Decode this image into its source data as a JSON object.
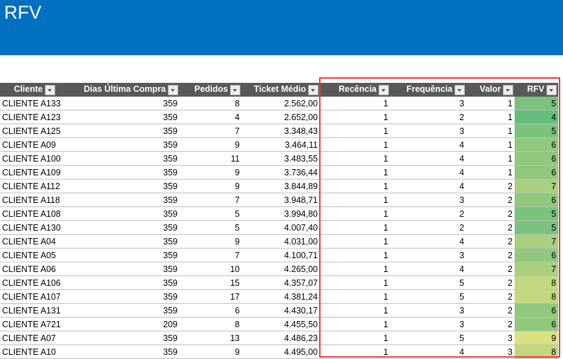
{
  "title": "RFV",
  "headers": [
    "Cliente",
    "Dias Última Compra",
    "Pedidos",
    "Ticket Médio",
    "Recência",
    "Frequência",
    "Valor",
    "RFV"
  ],
  "rfv_colors": {
    "4": "#63be7b",
    "5": "#79c37c",
    "6": "#90c97d",
    "7": "#a8d07e",
    "8": "#c2d87f",
    "9": "#dbe180"
  },
  "rows": [
    [
      "CLIENTE A133",
      "359",
      "8",
      "2.562,00",
      "1",
      "3",
      "1",
      "5"
    ],
    [
      "CLIENTE A123",
      "359",
      "4",
      "2.652,00",
      "1",
      "2",
      "1",
      "4"
    ],
    [
      "CLIENTE A125",
      "359",
      "7",
      "3.348,43",
      "1",
      "3",
      "1",
      "5"
    ],
    [
      "CLIENTE A09",
      "359",
      "9",
      "3.464,11",
      "1",
      "4",
      "1",
      "6"
    ],
    [
      "CLIENTE A100",
      "359",
      "11",
      "3.483,55",
      "1",
      "4",
      "1",
      "6"
    ],
    [
      "CLIENTE A109",
      "359",
      "9",
      "3.736,44",
      "1",
      "4",
      "1",
      "6"
    ],
    [
      "CLIENTE A112",
      "359",
      "9",
      "3.844,89",
      "1",
      "4",
      "2",
      "7"
    ],
    [
      "CLIENTE A118",
      "359",
      "7",
      "3.948,71",
      "1",
      "3",
      "2",
      "6"
    ],
    [
      "CLIENTE A108",
      "359",
      "5",
      "3.994,80",
      "1",
      "2",
      "2",
      "5"
    ],
    [
      "CLIENTE A130",
      "359",
      "5",
      "4.007,40",
      "1",
      "2",
      "2",
      "5"
    ],
    [
      "CLIENTE A04",
      "359",
      "9",
      "4.031,00",
      "1",
      "4",
      "2",
      "7"
    ],
    [
      "CLIENTE A05",
      "359",
      "7",
      "4.100,71",
      "1",
      "3",
      "2",
      "6"
    ],
    [
      "CLIENTE A06",
      "359",
      "10",
      "4.265,00",
      "1",
      "4",
      "2",
      "7"
    ],
    [
      "CLIENTE A106",
      "359",
      "15",
      "4.357,07",
      "1",
      "5",
      "2",
      "8"
    ],
    [
      "CLIENTE A107",
      "359",
      "17",
      "4.381,24",
      "1",
      "5",
      "2",
      "8"
    ],
    [
      "CLIENTE A131",
      "359",
      "6",
      "4.430,17",
      "1",
      "3",
      "2",
      "6"
    ],
    [
      "CLIENTE A721",
      "209",
      "8",
      "4.455,50",
      "1",
      "3",
      "2",
      "6"
    ],
    [
      "CLIENTE A07",
      "359",
      "13",
      "4.486,23",
      "1",
      "5",
      "3",
      "9"
    ],
    [
      "CLIENTE A10",
      "359",
      "9",
      "4.495,00",
      "1",
      "4",
      "3",
      "8"
    ]
  ]
}
